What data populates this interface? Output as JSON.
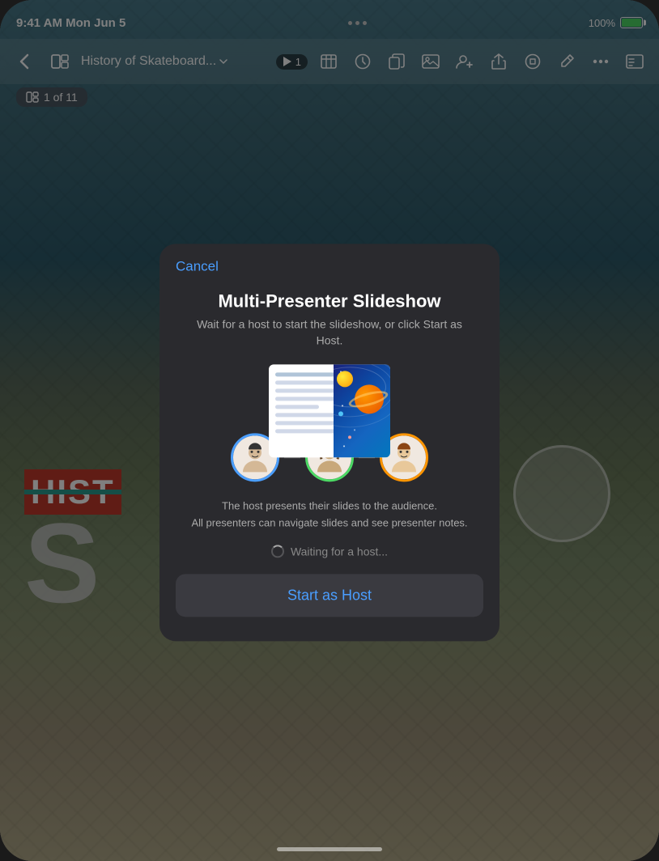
{
  "status_bar": {
    "time": "9:41 AM",
    "date": "Mon Jun 5",
    "battery_percent": "100%"
  },
  "toolbar": {
    "title": "History of Skateboard...",
    "slide_counter": "1 of 11"
  },
  "modal": {
    "cancel_label": "Cancel",
    "title": "Multi-Presenter Slideshow",
    "subtitle": "Wait for a host to start the slideshow, or click Start as Host.",
    "description_line1": "The host presents their slides to the audience.",
    "description_line2": "All presenters can navigate slides and see presenter notes.",
    "waiting_label": "Waiting for a host...",
    "start_host_label": "Start as Host"
  },
  "avatars": [
    {
      "border_color": "#4a9eff",
      "label": "presenter-1"
    },
    {
      "border_color": "#4cd964",
      "label": "presenter-2"
    },
    {
      "border_color": "#ff9500",
      "label": "presenter-3"
    }
  ],
  "slide": {
    "hist_text": "HIST",
    "big_letter": "S"
  }
}
